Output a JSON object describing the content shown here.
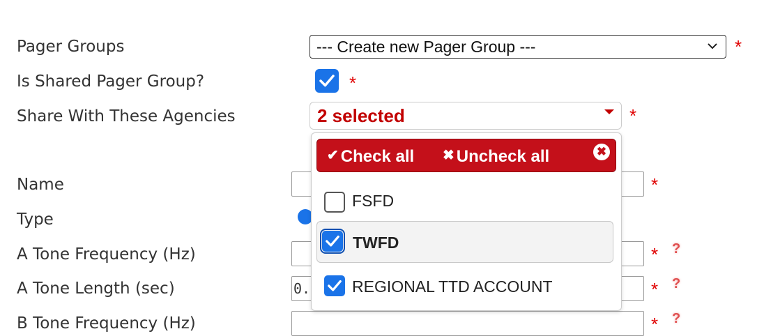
{
  "form": {
    "pager_groups_label": "Pager Groups",
    "pager_groups_value": "--- Create new Pager Group ---",
    "shared_label": "Is Shared Pager Group?",
    "shared_checked": true,
    "share_with_label": "Share With These Agencies",
    "share_with_value": "2 selected",
    "name_label": "Name",
    "type_label": "Type",
    "a_tone_freq_label": "A Tone Frequency (Hz)",
    "a_tone_length_label": "A Tone Length (sec)",
    "a_tone_length_value": "0.",
    "b_tone_freq_label": "B Tone Frequency (Hz)",
    "required_mark": "*",
    "help_mark": "?"
  },
  "multiselect": {
    "check_all_label": "Check all",
    "uncheck_all_label": "Uncheck all",
    "options": [
      {
        "label": "FSFD",
        "checked": false
      },
      {
        "label": "TWFD",
        "checked": true
      },
      {
        "label": "REGIONAL TTD ACCOUNT",
        "checked": true
      }
    ]
  },
  "colors": {
    "accent_blue": "#1a73e8",
    "required_red": "#e00000",
    "header_red": "#c4101a"
  },
  "icons": {
    "check_all": "checkmark-icon",
    "uncheck_all": "x-icon",
    "close": "close-circle-icon",
    "dropdown": "chevron-down-icon"
  }
}
